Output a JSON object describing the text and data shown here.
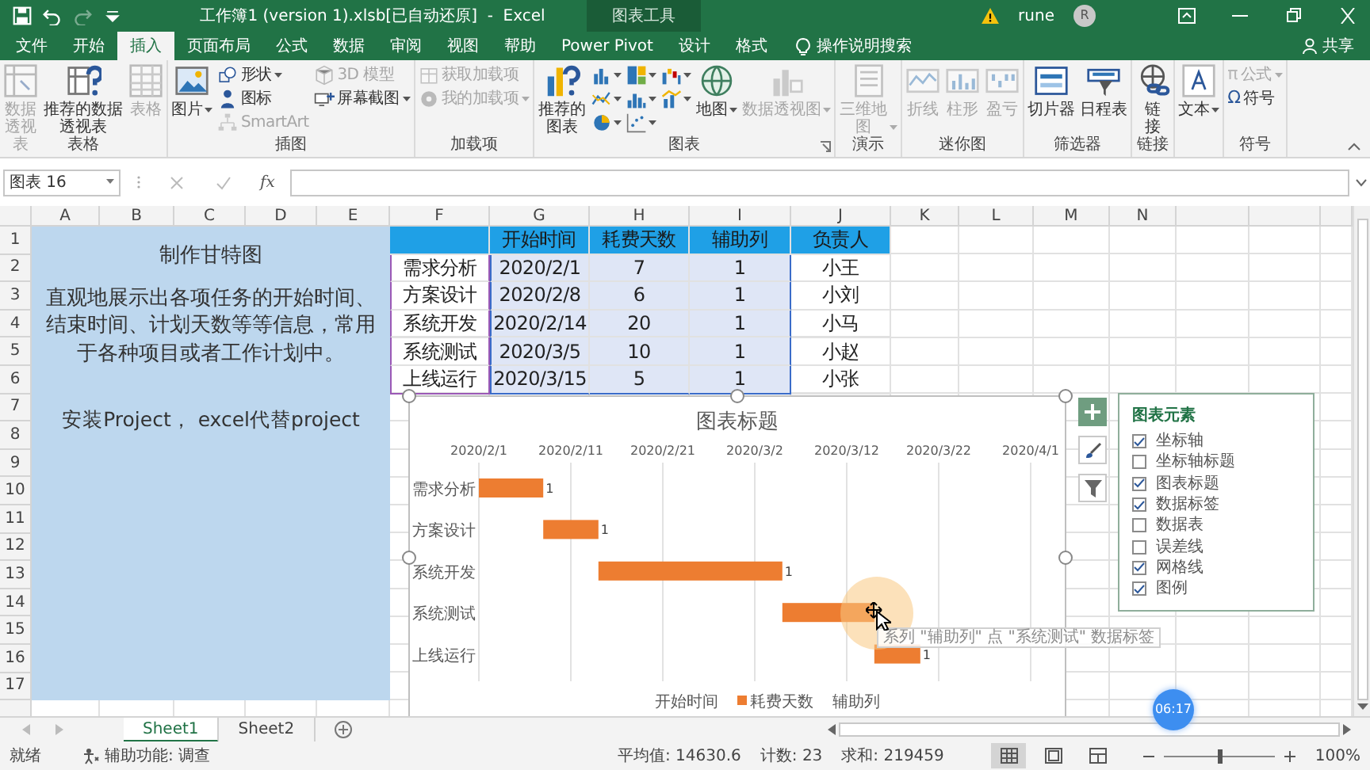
{
  "window": {
    "title": "工作簿1 (version 1).xlsb[已自动还原]  -  Excel",
    "context_tools": "图表工具",
    "user": "rune",
    "avatar": "R"
  },
  "quick_access": [
    {
      "kind": "save",
      "disabled": false
    },
    {
      "kind": "undo",
      "disabled": false
    },
    {
      "kind": "redo",
      "disabled": true
    },
    {
      "kind": "customize",
      "disabled": false
    }
  ],
  "tabs": [
    {
      "label": "文件",
      "selected": false
    },
    {
      "label": "开始",
      "selected": false
    },
    {
      "label": "插入",
      "selected": true
    },
    {
      "label": "页面布局",
      "selected": false
    },
    {
      "label": "公式",
      "selected": false
    },
    {
      "label": "数据",
      "selected": false
    },
    {
      "label": "审阅",
      "selected": false
    },
    {
      "label": "视图",
      "selected": false
    },
    {
      "label": "帮助",
      "selected": false
    },
    {
      "label": "Power Pivot",
      "selected": false
    },
    {
      "label": "设计",
      "selected": false
    },
    {
      "label": "格式",
      "selected": false
    }
  ],
  "tell_me": "操作说明搜索",
  "share": "共享",
  "ribbon": [
    {
      "label": "表格",
      "columns": [
        {
          "kind": "large",
          "items": [
            {
              "label": "数据透视表",
              "disabled": true
            }
          ]
        },
        {
          "kind": "large",
          "items": [
            {
              "label": "推荐的数据透视表",
              "disabled": false
            }
          ]
        },
        {
          "kind": "large",
          "items": [
            {
              "label": "表格",
              "disabled": true
            }
          ]
        }
      ]
    },
    {
      "label": "插图",
      "columns": [
        {
          "kind": "large",
          "items": [
            {
              "label": "图片",
              "disabled": false,
              "dropdown": true
            }
          ]
        },
        {
          "kind": "small",
          "items": [
            {
              "label": "形状",
              "disabled": false,
              "dropdown": true
            },
            {
              "label": "图标",
              "disabled": false
            },
            {
              "label": "SmartArt",
              "disabled": true
            }
          ]
        },
        {
          "kind": "small",
          "items": [
            {
              "label": "3D 模型",
              "disabled": true
            },
            {
              "label": "屏幕截图",
              "disabled": false,
              "dropdown": true
            }
          ]
        }
      ]
    },
    {
      "label": "加载项",
      "columns": [
        {
          "kind": "small",
          "items": [
            {
              "label": "获取加载项",
              "disabled": true
            },
            {
              "label": "我的加载项",
              "disabled": true,
              "dropdown": true
            }
          ]
        }
      ]
    },
    {
      "label": "图表",
      "launcher": true,
      "columns": [
        {
          "kind": "large",
          "items": [
            {
              "label": "推荐的图表",
              "disabled": false
            }
          ]
        },
        {
          "kind": "icons",
          "items": [
            {
              "disabled": false,
              "dropdown": true
            },
            {
              "disabled": false,
              "dropdown": true
            },
            {
              "disabled": false,
              "dropdown": true
            }
          ]
        },
        {
          "kind": "icons",
          "items": [
            {
              "disabled": false,
              "dropdown": true
            },
            {
              "disabled": false,
              "dropdown": true
            },
            {
              "disabled": false,
              "dropdown": true
            }
          ]
        },
        {
          "kind": "icons",
          "items": [
            {
              "disabled": false,
              "dropdown": true
            },
            {
              "disabled": false,
              "dropdown": true
            }
          ]
        },
        {
          "kind": "large",
          "items": [
            {
              "label": "地图",
              "disabled": false,
              "dropdown": true
            }
          ]
        },
        {
          "kind": "large",
          "items": [
            {
              "label": "数据透视图",
              "disabled": true,
              "dropdown": true
            }
          ]
        }
      ]
    },
    {
      "label": "演示",
      "columns": [
        {
          "kind": "large",
          "items": [
            {
              "label": "三维地图",
              "disabled": true,
              "dropdown": true
            }
          ]
        }
      ]
    },
    {
      "label": "迷你图",
      "columns": [
        {
          "kind": "large",
          "items": [
            {
              "label": "折线",
              "disabled": true
            }
          ]
        },
        {
          "kind": "large",
          "items": [
            {
              "label": "柱形",
              "disabled": true
            }
          ]
        },
        {
          "kind": "large",
          "items": [
            {
              "label": "盈亏",
              "disabled": true
            }
          ]
        }
      ]
    },
    {
      "label": "筛选器",
      "columns": [
        {
          "kind": "large",
          "items": [
            {
              "label": "切片器",
              "disabled": false
            }
          ]
        },
        {
          "kind": "large",
          "items": [
            {
              "label": "日程表",
              "disabled": false
            }
          ]
        }
      ]
    },
    {
      "label": "链接",
      "columns": [
        {
          "kind": "large",
          "items": [
            {
              "label": "链接",
              "disabled": false
            }
          ]
        }
      ]
    },
    {
      "columns": [
        {
          "kind": "large",
          "items": [
            {
              "label": "文本",
              "disabled": false,
              "dropdown": true
            }
          ]
        }
      ]
    },
    {
      "label": "符号",
      "columns": [
        {
          "kind": "small",
          "items": [
            {
              "label": "公式",
              "glyph": "π",
              "disabled": true,
              "dropdown": true
            },
            {
              "label": "符号",
              "glyph": "Ω",
              "disabled": false
            }
          ]
        }
      ]
    }
  ],
  "formula_bar": {
    "name_box": "图表 16",
    "function_label": "fx"
  },
  "sheet": {
    "columns": [
      "A",
      "B",
      "C",
      "D",
      "E",
      "F",
      "G",
      "H",
      "I",
      "J",
      "K",
      "L",
      "M",
      "N"
    ],
    "rows": [
      "1",
      "2",
      "3",
      "4",
      "5",
      "6",
      "7",
      "8",
      "9",
      "10",
      "11",
      "12",
      "13",
      "14",
      "15",
      "16",
      "17"
    ],
    "note": {
      "title": "制作甘特图",
      "description": "直观地展示出各项任务的开始时间、结束时间、计划天数等等信息，常用于各种项目或者工作计划中。",
      "footer": "安装Project， excel代替project"
    },
    "table": {
      "columns": [
        "开始时间",
        "耗费天数",
        "辅助列",
        "负责人"
      ],
      "rows": [
        {
          "task": "需求分析",
          "start": "2020/2/1",
          "days": "7",
          "helper": "1",
          "owner": "小王"
        },
        {
          "task": "方案设计",
          "start": "2020/2/8",
          "days": "6",
          "helper": "1",
          "owner": "小刘"
        },
        {
          "task": "系统开发",
          "start": "2020/2/14",
          "days": "20",
          "helper": "1",
          "owner": "小马"
        },
        {
          "task": "系统测试",
          "start": "2020/3/5",
          "days": "10",
          "helper": "1",
          "owner": "小赵"
        },
        {
          "task": "上线运行",
          "start": "2020/3/15",
          "days": "5",
          "helper": "1",
          "owner": "小张"
        }
      ]
    }
  },
  "chart": {
    "title": "图表标题",
    "axis_labels": [
      "2020/2/1",
      "2020/2/11",
      "2020/2/21",
      "2020/3/2",
      "2020/3/12",
      "2020/3/22",
      "2020/4/1"
    ],
    "rows": [
      {
        "label": "需求分析",
        "data_label": "1"
      },
      {
        "label": "方案设计",
        "data_label": "1"
      },
      {
        "label": "系统开发",
        "data_label": "1"
      },
      {
        "label": "系统测试"
      },
      {
        "label": "上线运行",
        "data_label": "1"
      }
    ],
    "legend": [
      {
        "label": "开始时间"
      },
      {
        "label": "耗费天数",
        "color": "#ed7d31"
      },
      {
        "label": "辅助列"
      }
    ]
  },
  "chart_buttons": [
    {
      "kind": "elements",
      "selected": true
    },
    {
      "kind": "styles",
      "selected": false
    },
    {
      "kind": "filters",
      "selected": false
    }
  ],
  "chart_elements": {
    "title": "图表元素",
    "items": [
      {
        "label": "坐标轴",
        "checked": true
      },
      {
        "label": "坐标轴标题",
        "checked": false
      },
      {
        "label": "图表标题",
        "checked": true
      },
      {
        "label": "数据标签",
        "checked": true
      },
      {
        "label": "数据表",
        "checked": false
      },
      {
        "label": "误差线",
        "checked": false
      },
      {
        "label": "网格线",
        "checked": true
      },
      {
        "label": "图例",
        "checked": true
      }
    ]
  },
  "tooltip": "系列 \"辅助列\" 点 \"系统测试\" 数据标签",
  "sheet_tabs": [
    {
      "label": "Sheet1",
      "selected": true
    },
    {
      "label": "Sheet2",
      "selected": false
    }
  ],
  "status_bar": {
    "ready": "就绪",
    "accessibility": "辅助功能: 调查",
    "average": "平均值: 14630.6",
    "count": "计数: 23",
    "sum": "求和: 219459",
    "views": [
      {
        "kind": "normal",
        "selected": true
      },
      {
        "kind": "page_layout",
        "selected": false
      },
      {
        "kind": "page_break",
        "selected": false
      }
    ],
    "zoom": {
      "level": 0.5,
      "label": "100%"
    }
  },
  "timer": "06:17"
}
